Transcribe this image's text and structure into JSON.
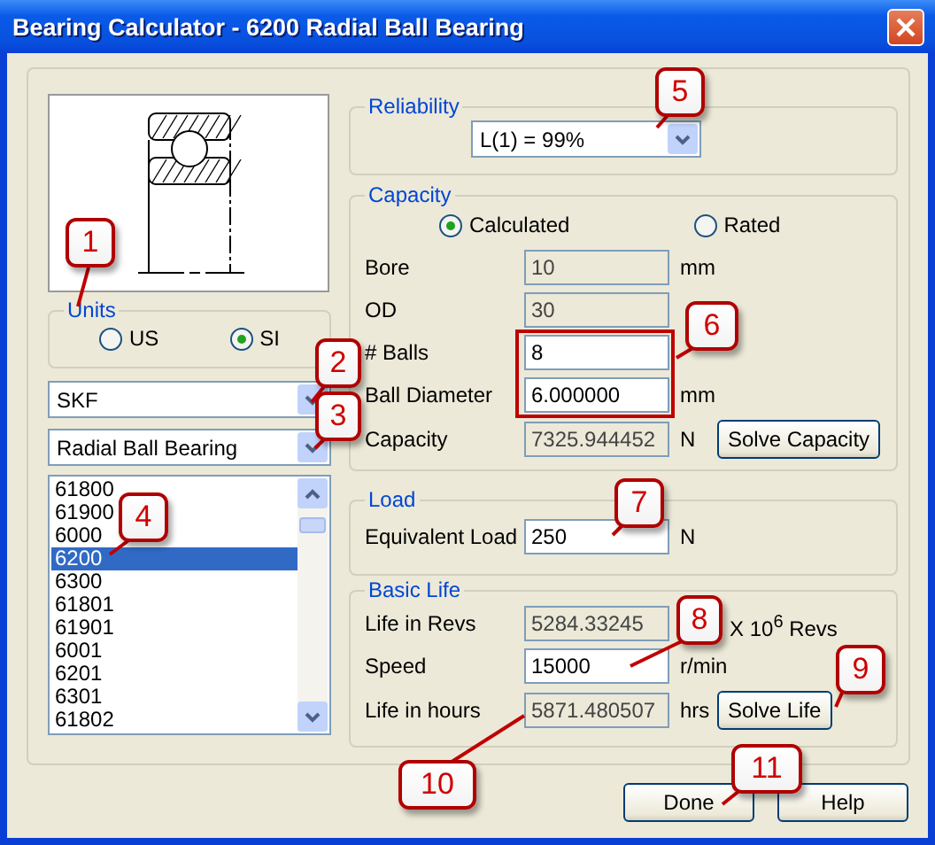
{
  "window": {
    "title": "Bearing Calculator - 6200 Radial Ball Bearing"
  },
  "units": {
    "label": "Units",
    "options": [
      {
        "label": "US",
        "selected": false
      },
      {
        "label": "SI",
        "selected": true
      }
    ]
  },
  "manufacturer": {
    "value": "SKF"
  },
  "bearing_type": {
    "value": "Radial Ball Bearing"
  },
  "bearing_list": {
    "items": [
      {
        "label": "61800",
        "selected": false
      },
      {
        "label": "61900",
        "selected": false
      },
      {
        "label": "6000",
        "selected": false
      },
      {
        "label": "6200",
        "selected": true
      },
      {
        "label": "6300",
        "selected": false
      },
      {
        "label": "61801",
        "selected": false
      },
      {
        "label": "61901",
        "selected": false
      },
      {
        "label": "6001",
        "selected": false
      },
      {
        "label": "6201",
        "selected": false
      },
      {
        "label": "6301",
        "selected": false
      },
      {
        "label": "61802",
        "selected": false
      }
    ]
  },
  "reliability": {
    "label": "Reliability",
    "value": "L(1) = 99%"
  },
  "capacity": {
    "label": "Capacity",
    "modes": [
      {
        "label": "Calculated",
        "selected": true
      },
      {
        "label": "Rated",
        "selected": false
      }
    ],
    "fields": [
      {
        "label": "Bore",
        "value": "10",
        "unit": "mm",
        "disabled": true
      },
      {
        "label": "OD",
        "value": "30",
        "disabled": true
      },
      {
        "label": "# Balls",
        "value": "8",
        "disabled": false
      },
      {
        "label": "Ball Diameter",
        "value": "6.000000",
        "unit": "mm",
        "disabled": false
      },
      {
        "label": "Capacity",
        "value": "7325.944452",
        "unit": "N",
        "disabled": true
      }
    ],
    "button": "Solve Capacity"
  },
  "load": {
    "label": "Load",
    "fields": [
      {
        "label": "Equivalent Load",
        "value": "250",
        "unit": "N",
        "disabled": false
      }
    ]
  },
  "basic_life": {
    "label": "Basic Life",
    "fields": [
      {
        "label": "Life in Revs",
        "value": "5284.33245",
        "unit": "X 10$^{6}$ Revs",
        "disabled": true
      },
      {
        "label": "Speed",
        "value": "15000",
        "unit": "r/min",
        "disabled": false
      },
      {
        "label": "Life in hours",
        "value": "5871.480507",
        "unit": "hrs",
        "disabled": true
      }
    ],
    "button": "Solve Life"
  },
  "buttons": [
    "Done",
    "Help"
  ],
  "callouts": [
    {
      "label": "1"
    },
    {
      "label": "2"
    },
    {
      "label": "3"
    },
    {
      "label": "4"
    },
    {
      "label": "5"
    },
    {
      "label": "6"
    },
    {
      "label": "7"
    },
    {
      "label": "8"
    },
    {
      "label": "9"
    },
    {
      "label": "10"
    },
    {
      "label": "11"
    }
  ]
}
